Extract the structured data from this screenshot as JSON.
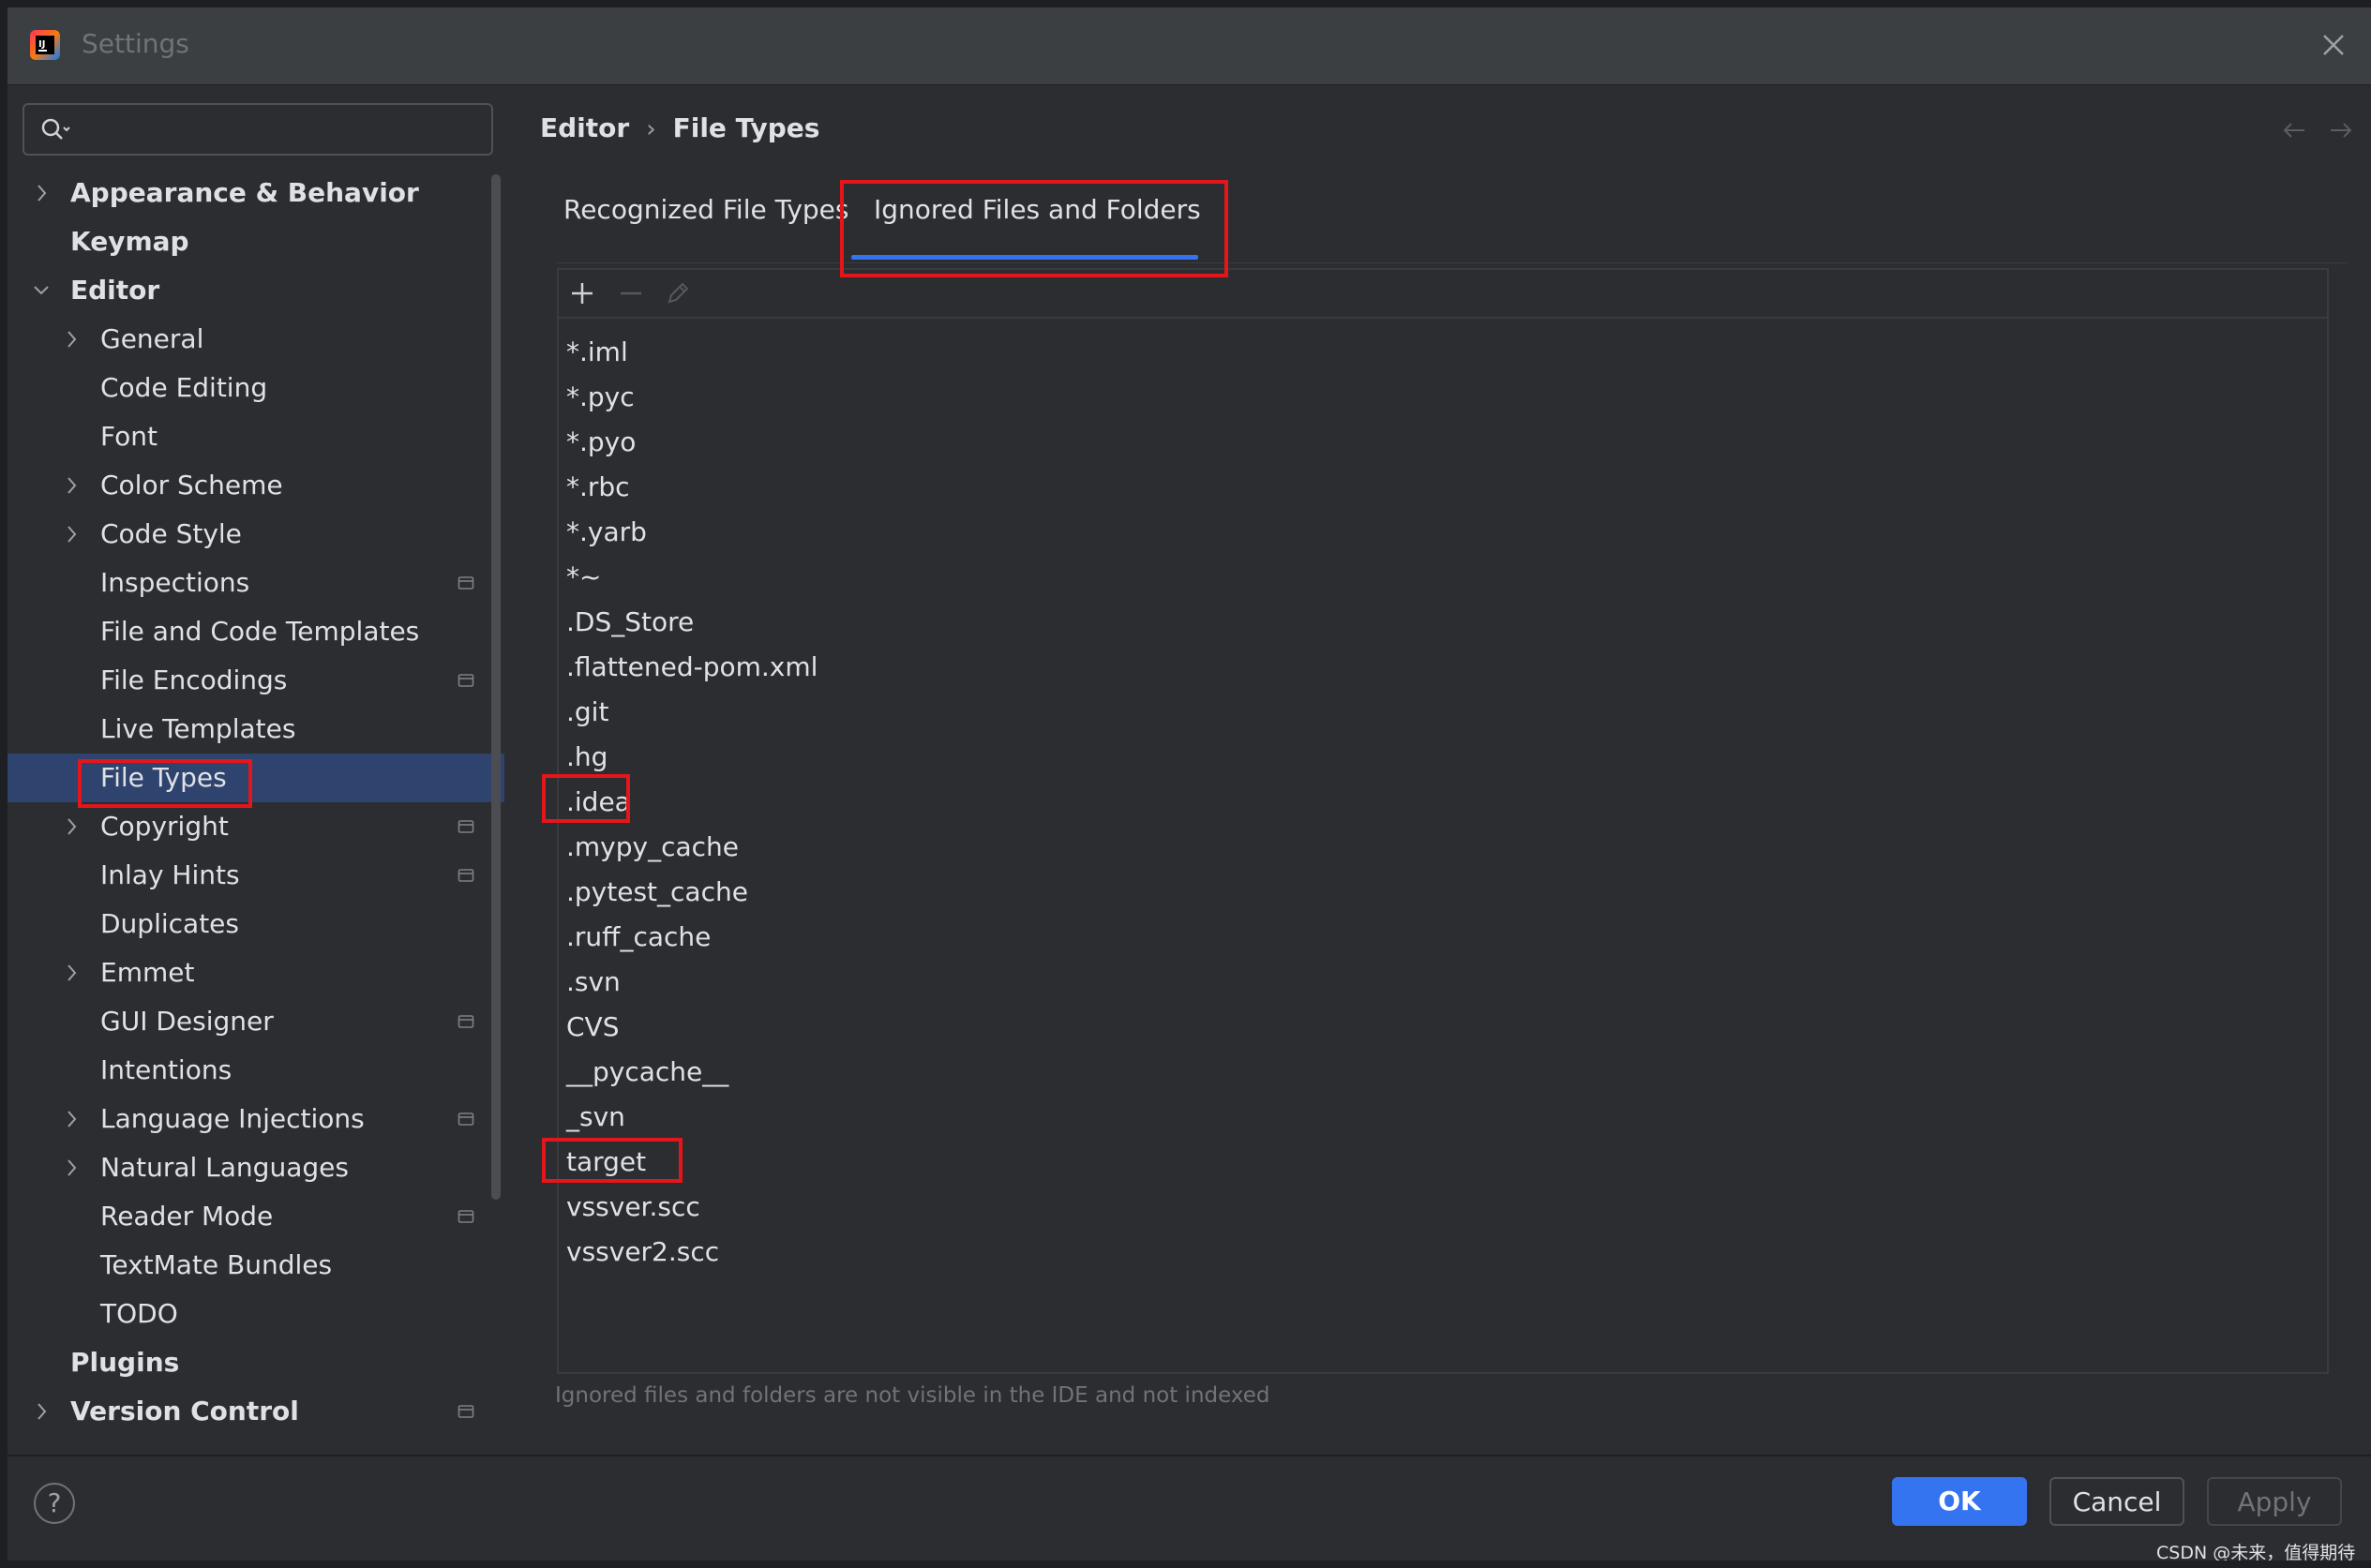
{
  "window": {
    "title": "Settings"
  },
  "search": {
    "value": "",
    "placeholder": ""
  },
  "tree": {
    "items": [
      {
        "label": "Appearance & Behavior",
        "level": 0,
        "bold": true,
        "expandable": true,
        "expanded": false
      },
      {
        "label": "Keymap",
        "level": 0,
        "bold": true,
        "expandable": false
      },
      {
        "label": "Editor",
        "level": 0,
        "bold": true,
        "expandable": true,
        "expanded": true
      },
      {
        "label": "General",
        "level": 1,
        "expandable": true
      },
      {
        "label": "Code Editing",
        "level": 1
      },
      {
        "label": "Font",
        "level": 1
      },
      {
        "label": "Color Scheme",
        "level": 1,
        "expandable": true
      },
      {
        "label": "Code Style",
        "level": 1,
        "expandable": true
      },
      {
        "label": "Inspections",
        "level": 1,
        "project_icon": true
      },
      {
        "label": "File and Code Templates",
        "level": 1
      },
      {
        "label": "File Encodings",
        "level": 1,
        "project_icon": true
      },
      {
        "label": "Live Templates",
        "level": 1
      },
      {
        "label": "File Types",
        "level": 1,
        "selected": true
      },
      {
        "label": "Copyright",
        "level": 1,
        "expandable": true,
        "project_icon": true
      },
      {
        "label": "Inlay Hints",
        "level": 1,
        "project_icon": true
      },
      {
        "label": "Duplicates",
        "level": 1
      },
      {
        "label": "Emmet",
        "level": 1,
        "expandable": true
      },
      {
        "label": "GUI Designer",
        "level": 1,
        "project_icon": true
      },
      {
        "label": "Intentions",
        "level": 1
      },
      {
        "label": "Language Injections",
        "level": 1,
        "expandable": true,
        "project_icon": true
      },
      {
        "label": "Natural Languages",
        "level": 1,
        "expandable": true
      },
      {
        "label": "Reader Mode",
        "level": 1,
        "project_icon": true
      },
      {
        "label": "TextMate Bundles",
        "level": 1
      },
      {
        "label": "TODO",
        "level": 1
      },
      {
        "label": "Plugins",
        "level": 0,
        "bold": true
      },
      {
        "label": "Version Control",
        "level": 0,
        "bold": true,
        "expandable": true,
        "project_icon": true
      }
    ]
  },
  "breadcrumb": {
    "parent": "Editor",
    "current": "File Types"
  },
  "tabs": [
    {
      "label": "Recognized File Types",
      "active": false
    },
    {
      "label": "Ignored Files and Folders",
      "active": true
    }
  ],
  "toolbar": {
    "add_icon": "plus-icon",
    "remove_icon": "minus-icon",
    "edit_icon": "pencil-icon"
  },
  "ignored_items": [
    "*.iml",
    "*.pyc",
    "*.pyo",
    "*.rbc",
    "*.yarb",
    "*~",
    ".DS_Store",
    ".flattened-pom.xml",
    ".git",
    ".hg",
    ".idea",
    ".mypy_cache",
    ".pytest_cache",
    ".ruff_cache",
    ".svn",
    "CVS",
    "__pycache__",
    "_svn",
    "target",
    "vssver.scc",
    "vssver2.scc"
  ],
  "hint": "Ignored files and folders are not visible in the IDE and not indexed",
  "footer": {
    "help": "?",
    "ok": "OK",
    "cancel": "Cancel",
    "apply": "Apply"
  },
  "watermark": "CSDN @未来，值得期待",
  "colors": {
    "accent": "#3574f0",
    "selection": "#2e436e",
    "annotation": "#e5161b",
    "background": "#2b2d30"
  }
}
